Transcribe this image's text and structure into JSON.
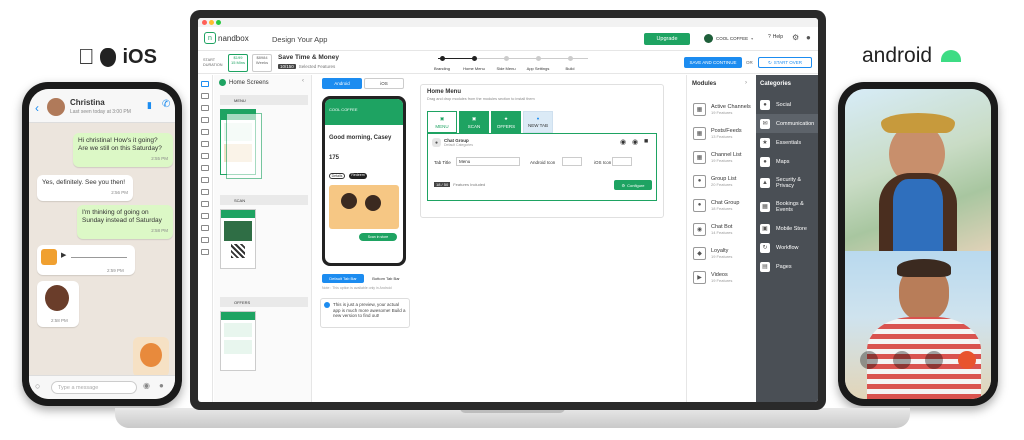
{
  "ios_label": "iOS",
  "android_label": "android",
  "ios_chat": {
    "contact": "Christina",
    "status": "Last seen today at 3:00 PM",
    "input_placeholder": "Type a message",
    "messages": [
      {
        "text": "Hi christina! How's it going? Are we still on this Saturday?",
        "time": "2:55 PM",
        "me": true
      },
      {
        "text": "Yes, definitely. See you then!",
        "time": "2:56 PM",
        "me": false
      },
      {
        "text": "I'm thinking of going on Sunday instead of Saturday",
        "time": "2:58 PM",
        "me": true
      },
      {
        "text": "",
        "time": "2:59 PM",
        "me": false
      },
      {
        "text": "",
        "time": "2:58 PM",
        "me": false
      }
    ]
  },
  "app": {
    "logo": "nandbox",
    "title": "Design Your App",
    "upgrade": "Upgrade",
    "account": "COOL COFFEE",
    "help": "Help",
    "save_time": {
      "start_label": "START DURATION",
      "price_badge": "$199",
      "price_time": "15 Mins",
      "alt_badge": "$8984",
      "alt_time": "Weeks",
      "title": "Save Time & Money",
      "count": "10/150",
      "sub": "Selected Features"
    },
    "steps": [
      "Branding",
      "Home Menu",
      "Side Menu",
      "App Settings",
      "Build"
    ],
    "save_continue": "SAVE AND CONTINUE",
    "or": "OR",
    "start_over": "START OVER",
    "home_screens": "Home Screens",
    "screen_labels": [
      "MENU",
      "SCAN",
      "OFFERS"
    ],
    "platform_tabs": [
      "Android",
      "iOS"
    ],
    "preview": {
      "brand": "COOL COFFEE",
      "greeting": "Good morning, Casey",
      "points": "175",
      "btn1": "Details",
      "btn2": "Redeem",
      "scan_btn": "Scan in store"
    },
    "tabbar_buttons": [
      "Default Tab Bar",
      "Bottom Tab Bar"
    ],
    "tabbar_note": "Note : This option is available only in Android",
    "preview_note": "This is just a preview, your actual app is much more awesome! Build a new version to find out!",
    "home_menu": {
      "title": "Home Menu",
      "sub": "Drag and drop modules from the modules section to install them",
      "tabs": [
        "MENU",
        "SCAN",
        "OFFERS",
        "NEW TAB"
      ],
      "chat_group": "Chat Group",
      "chat_sub": "Default Categories",
      "tab_title_label": "Tab Title",
      "tab_title_value": "Menu",
      "android_icon": "Android Icon",
      "ios_icon": "iOS Icon",
      "count": "18 / 50",
      "features": "Features Included",
      "configure": "Configure"
    },
    "modules_title": "Modules",
    "modules": [
      {
        "name": "Active Channels",
        "sub": "19 Features"
      },
      {
        "name": "Posts/Feeds",
        "sub": "13 Features"
      },
      {
        "name": "Channel List",
        "sub": "19 Features"
      },
      {
        "name": "Group List",
        "sub": "20 Features"
      },
      {
        "name": "Chat Group",
        "sub": "18 Features"
      },
      {
        "name": "Chat Bot",
        "sub": "14 Features"
      },
      {
        "name": "Loyalty",
        "sub": "19 Features"
      },
      {
        "name": "Videos",
        "sub": "19 Features"
      }
    ],
    "categories_title": "Categories",
    "categories": [
      "Social",
      "Communication",
      "Essentials",
      "Maps",
      "Security & Privacy",
      "Bookings & Events",
      "Mobile Store",
      "Workflow",
      "Pages"
    ]
  },
  "colors": {
    "brand": "#1ea362",
    "accent_blue": "#1c8cf0",
    "sidebar_dark": "#4a4f55"
  }
}
